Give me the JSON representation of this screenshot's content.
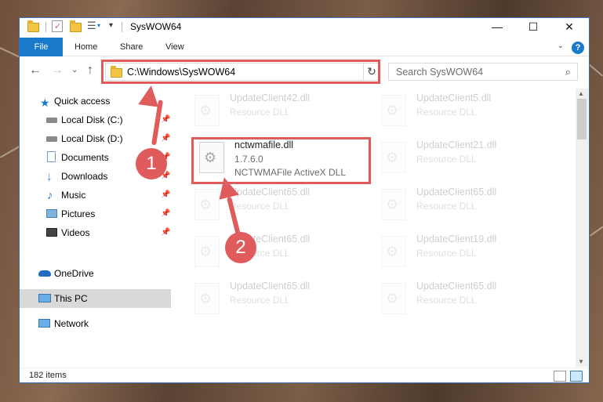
{
  "window": {
    "title": "SysWOW64",
    "controls": {
      "minimize": "—",
      "maximize": "☐",
      "close": "✕"
    }
  },
  "ribbon": {
    "tabs": [
      "File",
      "Home",
      "Share",
      "View"
    ],
    "help": "?"
  },
  "address_bar": {
    "path": "C:\\Windows\\SysWOW64"
  },
  "search": {
    "placeholder": "Search SysWOW64"
  },
  "sidebar": {
    "items": [
      {
        "label": "Quick access",
        "icon": "star-icon"
      },
      {
        "label": "Local Disk (C:)",
        "icon": "drive-icon",
        "pinned": true
      },
      {
        "label": "Local Disk (D:)",
        "icon": "drive-icon",
        "pinned": true
      },
      {
        "label": "Documents",
        "icon": "documents-icon",
        "pinned": true
      },
      {
        "label": "Downloads",
        "icon": "download-icon",
        "pinned": true
      },
      {
        "label": "Music",
        "icon": "music-icon",
        "pinned": true
      },
      {
        "label": "Pictures",
        "icon": "pictures-icon",
        "pinned": true
      },
      {
        "label": "Videos",
        "icon": "videos-icon",
        "pinned": true
      },
      {
        "label": "OneDrive",
        "icon": "cloud-icon"
      },
      {
        "label": "This PC",
        "icon": "computer-icon",
        "selected": true
      },
      {
        "label": "Network",
        "icon": "network-icon"
      }
    ]
  },
  "files": {
    "col1": [
      {
        "name": "UpdateClient42.dll",
        "type": "Resource DLL"
      },
      {
        "name": "nctwmafile.dll",
        "version": "1.7.6.0",
        "type": "NCTWMAFile ActiveX DLL"
      },
      {
        "name": "UpdateClient65.dll",
        "type": "Resource DLL"
      },
      {
        "name": "UpdateClient65.dll",
        "type": "Resource DLL"
      },
      {
        "name": "UpdateClient65.dll",
        "type": "Resource DLL"
      }
    ],
    "col2": [
      {
        "name": "UpdateClient5.dll",
        "type": "Resource DLL"
      },
      {
        "name": "UpdateClient21.dll",
        "type": "Resource DLL"
      },
      {
        "name": "UpdateClient65.dll",
        "type": "Resource DLL"
      },
      {
        "name": "UpdateClient19.dll",
        "type": "Resource DLL"
      },
      {
        "name": "UpdateClient65.dll",
        "type": "Resource DLL"
      }
    ]
  },
  "status": {
    "item_count": "182 items"
  },
  "annotations": {
    "step1": "1",
    "step2": "2"
  },
  "colors": {
    "accent": "#1979ca",
    "highlight": "#e05b5b",
    "selected": "#d9d9d9"
  }
}
